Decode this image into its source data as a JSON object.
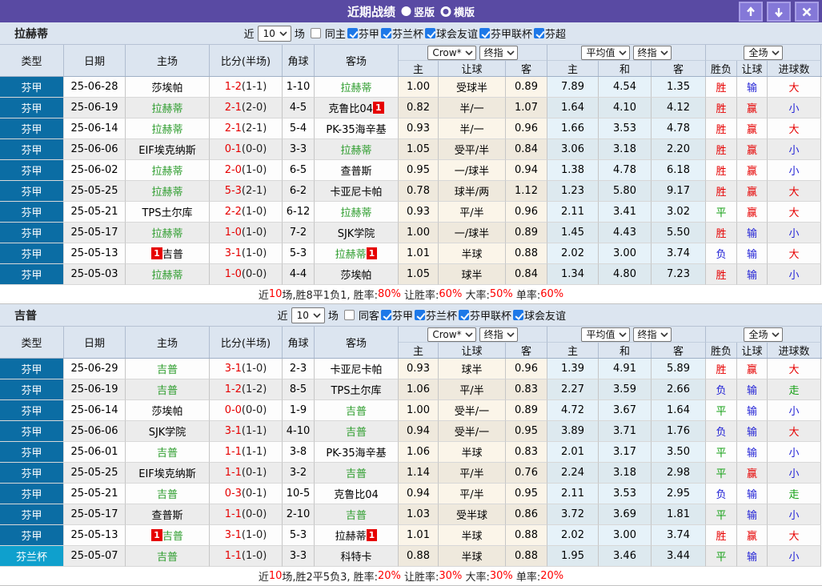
{
  "titlebar": {
    "title": "近期战绩",
    "radio_vertical": "竖版",
    "radio_horizontal": "横版"
  },
  "header": {
    "columns": [
      "类型",
      "日期",
      "主场",
      "比分(半场)",
      "角球",
      "客场",
      "主",
      "让球",
      "客",
      "主",
      "和",
      "客",
      "胜负",
      "让球",
      "进球数"
    ],
    "selects": {
      "odds_company": "Crow*",
      "odds_stage": "终指",
      "avg_label": "平均值",
      "avg_stage": "终指",
      "scope": "全场"
    }
  },
  "color_map": {
    "胜": "c-red",
    "平": "c-green",
    "负": "c-blue",
    "赢": "c-red",
    "输": "c-blue",
    "大": "c-red",
    "小": "c-blue",
    "走": "c-green"
  },
  "sections": [
    {
      "team": "拉赫蒂",
      "filter": {
        "near": "近",
        "count": "10",
        "games": "场",
        "same": "同主",
        "leagues": [
          "芬甲",
          "芬兰杯",
          "球会友谊",
          "芬甲联杯",
          "芬超"
        ]
      },
      "rows": [
        {
          "type": "芬甲",
          "date": "25-06-28",
          "home": "莎埃帕",
          "home_green": false,
          "home_badge": false,
          "score": "1-2",
          "half": "(1-1)",
          "corners": "1-10",
          "away": "拉赫蒂",
          "away_green": true,
          "away_badge": false,
          "odds": [
            "1.00",
            "受球半",
            "0.89"
          ],
          "avg": [
            "7.89",
            "4.54",
            "1.35"
          ],
          "result": "胜",
          "handicap": "输",
          "goals": "大"
        },
        {
          "type": "芬甲",
          "date": "25-06-19",
          "home": "拉赫蒂",
          "home_green": true,
          "home_badge": false,
          "score": "2-1",
          "half": "(2-0)",
          "corners": "4-5",
          "away": "克鲁比04",
          "away_green": false,
          "away_badge": true,
          "odds": [
            "0.82",
            "半/一",
            "1.07"
          ],
          "avg": [
            "1.64",
            "4.10",
            "4.12"
          ],
          "result": "胜",
          "handicap": "赢",
          "goals": "小"
        },
        {
          "type": "芬甲",
          "date": "25-06-14",
          "home": "拉赫蒂",
          "home_green": true,
          "home_badge": false,
          "score": "2-1",
          "half": "(2-1)",
          "corners": "5-4",
          "away": "PK-35海辛基",
          "away_green": false,
          "away_badge": false,
          "odds": [
            "0.93",
            "半/一",
            "0.96"
          ],
          "avg": [
            "1.66",
            "3.53",
            "4.78"
          ],
          "result": "胜",
          "handicap": "赢",
          "goals": "大"
        },
        {
          "type": "芬甲",
          "date": "25-06-06",
          "home": "EIF埃克纳斯",
          "home_green": false,
          "home_badge": false,
          "score": "0-1",
          "half": "(0-0)",
          "corners": "3-3",
          "away": "拉赫蒂",
          "away_green": true,
          "away_badge": false,
          "odds": [
            "1.05",
            "受平/半",
            "0.84"
          ],
          "avg": [
            "3.06",
            "3.18",
            "2.20"
          ],
          "result": "胜",
          "handicap": "赢",
          "goals": "小"
        },
        {
          "type": "芬甲",
          "date": "25-06-02",
          "home": "拉赫蒂",
          "home_green": true,
          "home_badge": false,
          "score": "2-0",
          "half": "(1-0)",
          "corners": "6-5",
          "away": "查普斯",
          "away_green": false,
          "away_badge": false,
          "odds": [
            "0.95",
            "一/球半",
            "0.94"
          ],
          "avg": [
            "1.38",
            "4.78",
            "6.18"
          ],
          "result": "胜",
          "handicap": "赢",
          "goals": "小"
        },
        {
          "type": "芬甲",
          "date": "25-05-25",
          "home": "拉赫蒂",
          "home_green": true,
          "home_badge": false,
          "score": "5-3",
          "half": "(2-1)",
          "corners": "6-2",
          "away": "卡亚尼卡帕",
          "away_green": false,
          "away_badge": false,
          "odds": [
            "0.78",
            "球半/两",
            "1.12"
          ],
          "avg": [
            "1.23",
            "5.80",
            "9.17"
          ],
          "result": "胜",
          "handicap": "赢",
          "goals": "大"
        },
        {
          "type": "芬甲",
          "date": "25-05-21",
          "home": "TPS土尔库",
          "home_green": false,
          "home_badge": false,
          "score": "2-2",
          "half": "(1-0)",
          "corners": "6-12",
          "away": "拉赫蒂",
          "away_green": true,
          "away_badge": false,
          "odds": [
            "0.93",
            "平/半",
            "0.96"
          ],
          "avg": [
            "2.11",
            "3.41",
            "3.02"
          ],
          "result": "平",
          "handicap": "赢",
          "goals": "大"
        },
        {
          "type": "芬甲",
          "date": "25-05-17",
          "home": "拉赫蒂",
          "home_green": true,
          "home_badge": false,
          "score": "1-0",
          "half": "(1-0)",
          "corners": "7-2",
          "away": "SJK学院",
          "away_green": false,
          "away_badge": false,
          "odds": [
            "1.00",
            "一/球半",
            "0.89"
          ],
          "avg": [
            "1.45",
            "4.43",
            "5.50"
          ],
          "result": "胜",
          "handicap": "输",
          "goals": "小"
        },
        {
          "type": "芬甲",
          "date": "25-05-13",
          "home": "吉普",
          "home_green": false,
          "home_badge": true,
          "score": "3-1",
          "half": "(1-0)",
          "corners": "5-3",
          "away": "拉赫蒂",
          "away_green": true,
          "away_badge": true,
          "odds": [
            "1.01",
            "半球",
            "0.88"
          ],
          "avg": [
            "2.02",
            "3.00",
            "3.74"
          ],
          "result": "负",
          "handicap": "输",
          "goals": "大"
        },
        {
          "type": "芬甲",
          "date": "25-05-03",
          "home": "拉赫蒂",
          "home_green": true,
          "home_badge": false,
          "score": "1-0",
          "half": "(0-0)",
          "corners": "4-4",
          "away": "莎埃帕",
          "away_green": false,
          "away_badge": false,
          "odds": [
            "1.05",
            "球半",
            "0.84"
          ],
          "avg": [
            "1.34",
            "4.80",
            "7.23"
          ],
          "result": "胜",
          "handicap": "输",
          "goals": "小"
        }
      ],
      "summary": [
        {
          "t": "近"
        },
        {
          "t": "10",
          "red": true
        },
        {
          "t": "场,胜8平1负1, 胜率:"
        },
        {
          "t": "80%",
          "red": true
        },
        {
          "t": " 让胜率:"
        },
        {
          "t": "60%",
          "red": true
        },
        {
          "t": " 大率:"
        },
        {
          "t": "50%",
          "red": true
        },
        {
          "t": " 单率:"
        },
        {
          "t": "60%",
          "red": true
        }
      ]
    },
    {
      "team": "吉普",
      "filter": {
        "near": "近",
        "count": "10",
        "games": "场",
        "same": "同客",
        "leagues": [
          "芬甲",
          "芬兰杯",
          "芬甲联杯",
          "球会友谊"
        ]
      },
      "rows": [
        {
          "type": "芬甲",
          "date": "25-06-29",
          "home": "吉普",
          "home_green": true,
          "home_badge": false,
          "score": "3-1",
          "half": "(1-0)",
          "corners": "2-3",
          "away": "卡亚尼卡帕",
          "away_green": false,
          "away_badge": false,
          "odds": [
            "0.93",
            "球半",
            "0.96"
          ],
          "avg": [
            "1.39",
            "4.91",
            "5.89"
          ],
          "result": "胜",
          "handicap": "赢",
          "goals": "大"
        },
        {
          "type": "芬甲",
          "date": "25-06-19",
          "home": "吉普",
          "home_green": true,
          "home_badge": false,
          "score": "1-2",
          "half": "(1-2)",
          "corners": "8-5",
          "away": "TPS土尔库",
          "away_green": false,
          "away_badge": false,
          "odds": [
            "1.06",
            "平/半",
            "0.83"
          ],
          "avg": [
            "2.27",
            "3.59",
            "2.66"
          ],
          "result": "负",
          "handicap": "输",
          "goals": "走"
        },
        {
          "type": "芬甲",
          "date": "25-06-14",
          "home": "莎埃帕",
          "home_green": false,
          "home_badge": false,
          "score": "0-0",
          "half": "(0-0)",
          "corners": "1-9",
          "away": "吉普",
          "away_green": true,
          "away_badge": false,
          "odds": [
            "1.00",
            "受半/一",
            "0.89"
          ],
          "avg": [
            "4.72",
            "3.67",
            "1.64"
          ],
          "result": "平",
          "handicap": "输",
          "goals": "小"
        },
        {
          "type": "芬甲",
          "date": "25-06-06",
          "home": "SJK学院",
          "home_green": false,
          "home_badge": false,
          "score": "3-1",
          "half": "(1-1)",
          "corners": "4-10",
          "away": "吉普",
          "away_green": true,
          "away_badge": false,
          "odds": [
            "0.94",
            "受半/一",
            "0.95"
          ],
          "avg": [
            "3.89",
            "3.71",
            "1.76"
          ],
          "result": "负",
          "handicap": "输",
          "goals": "大"
        },
        {
          "type": "芬甲",
          "date": "25-06-01",
          "home": "吉普",
          "home_green": true,
          "home_badge": false,
          "score": "1-1",
          "half": "(1-1)",
          "corners": "3-8",
          "away": "PK-35海辛基",
          "away_green": false,
          "away_badge": false,
          "odds": [
            "1.06",
            "半球",
            "0.83"
          ],
          "avg": [
            "2.01",
            "3.17",
            "3.50"
          ],
          "result": "平",
          "handicap": "输",
          "goals": "小"
        },
        {
          "type": "芬甲",
          "date": "25-05-25",
          "home": "EIF埃克纳斯",
          "home_green": false,
          "home_badge": false,
          "score": "1-1",
          "half": "(0-1)",
          "corners": "3-2",
          "away": "吉普",
          "away_green": true,
          "away_badge": false,
          "odds": [
            "1.14",
            "平/半",
            "0.76"
          ],
          "avg": [
            "2.24",
            "3.18",
            "2.98"
          ],
          "result": "平",
          "handicap": "赢",
          "goals": "小"
        },
        {
          "type": "芬甲",
          "date": "25-05-21",
          "home": "吉普",
          "home_green": true,
          "home_badge": false,
          "score": "0-3",
          "half": "(0-1)",
          "corners": "10-5",
          "away": "克鲁比04",
          "away_green": false,
          "away_badge": false,
          "odds": [
            "0.94",
            "平/半",
            "0.95"
          ],
          "avg": [
            "2.11",
            "3.53",
            "2.95"
          ],
          "result": "负",
          "handicap": "输",
          "goals": "走"
        },
        {
          "type": "芬甲",
          "date": "25-05-17",
          "home": "查普斯",
          "home_green": false,
          "home_badge": false,
          "score": "1-1",
          "half": "(0-0)",
          "corners": "2-10",
          "away": "吉普",
          "away_green": true,
          "away_badge": false,
          "odds": [
            "1.03",
            "受半球",
            "0.86"
          ],
          "avg": [
            "3.72",
            "3.69",
            "1.81"
          ],
          "result": "平",
          "handicap": "输",
          "goals": "小"
        },
        {
          "type": "芬甲",
          "date": "25-05-13",
          "home": "吉普",
          "home_green": true,
          "home_badge": true,
          "score": "3-1",
          "half": "(1-0)",
          "corners": "5-3",
          "away": "拉赫蒂",
          "away_green": false,
          "away_badge": true,
          "odds": [
            "1.01",
            "半球",
            "0.88"
          ],
          "avg": [
            "2.02",
            "3.00",
            "3.74"
          ],
          "result": "胜",
          "handicap": "赢",
          "goals": "大"
        },
        {
          "type": "芬兰杯",
          "type_light": true,
          "date": "25-05-07",
          "home": "吉普",
          "home_green": true,
          "home_badge": false,
          "score": "1-1",
          "half": "(1-0)",
          "corners": "3-3",
          "away": "科特卡",
          "away_green": false,
          "away_badge": false,
          "odds": [
            "0.88",
            "半球",
            "0.88"
          ],
          "avg": [
            "1.95",
            "3.46",
            "3.44"
          ],
          "result": "平",
          "handicap": "输",
          "goals": "小"
        }
      ],
      "summary": [
        {
          "t": "近"
        },
        {
          "t": "10",
          "red": true
        },
        {
          "t": "场,胜2平5负3, 胜率:"
        },
        {
          "t": "20%",
          "red": true
        },
        {
          "t": " 让胜率:"
        },
        {
          "t": "30%",
          "red": true
        },
        {
          "t": " 大率:"
        },
        {
          "t": "30%",
          "red": true
        },
        {
          "t": " 单率:"
        },
        {
          "t": "20%",
          "red": true
        }
      ]
    }
  ]
}
